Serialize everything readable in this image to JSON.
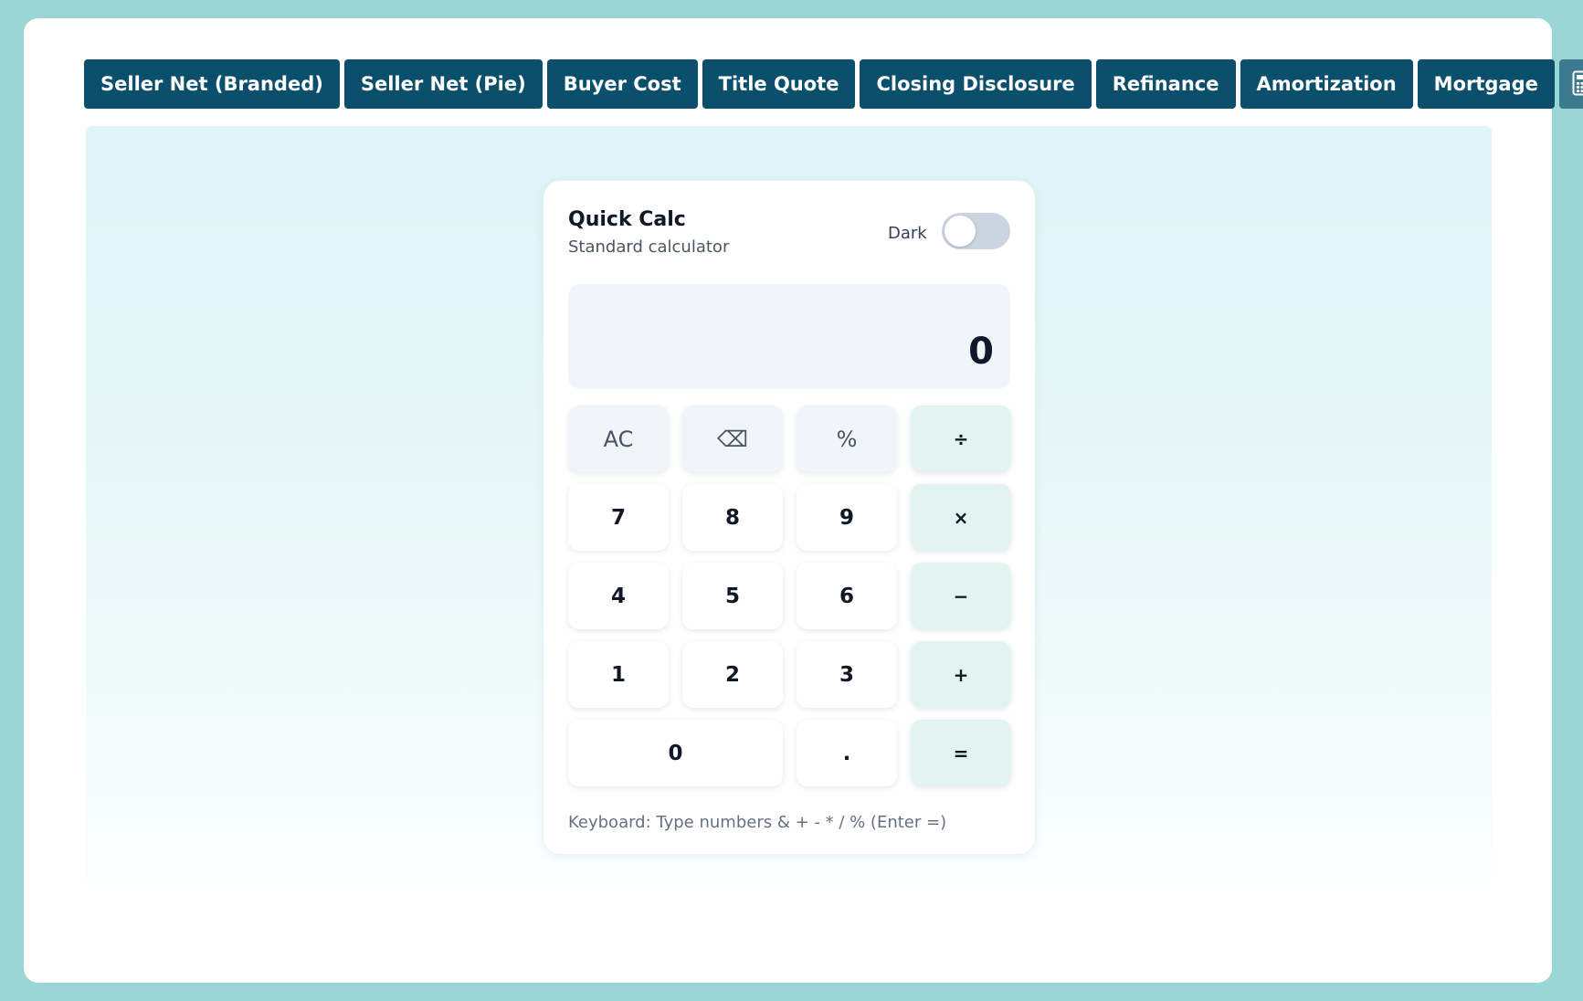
{
  "tabs": [
    {
      "label": "Seller Net (Branded)"
    },
    {
      "label": "Seller Net (Pie)"
    },
    {
      "label": "Buyer Cost"
    },
    {
      "label": "Title Quote"
    },
    {
      "label": "Closing Disclosure"
    },
    {
      "label": "Refinance"
    },
    {
      "label": "Amortization"
    },
    {
      "label": "Mortgage"
    }
  ],
  "calculator_tab_icon": "calculator-icon",
  "calculator": {
    "title": "Quick Calc",
    "subtitle": "Standard calculator",
    "dark_label": "Dark",
    "dark_mode": false,
    "display": "0",
    "keys": {
      "clear": "AC",
      "backspace": "⌫",
      "percent": "%",
      "divide": "÷",
      "seven": "7",
      "eight": "8",
      "nine": "9",
      "multiply": "×",
      "four": "4",
      "five": "5",
      "six": "6",
      "subtract": "−",
      "one": "1",
      "two": "2",
      "three": "3",
      "add": "+",
      "zero": "0",
      "decimal": ".",
      "equals": "="
    },
    "hint": "Keyboard: Type numbers & + - * / % (Enter =)"
  },
  "colors": {
    "outer_background": "#9bd6d6",
    "tab_background": "#0b4f6c",
    "tab_text": "#ffffff",
    "calc_tab_background": "#3b7a8f",
    "operator_key": "#e3f3f0",
    "function_key": "#f1f4f8"
  }
}
